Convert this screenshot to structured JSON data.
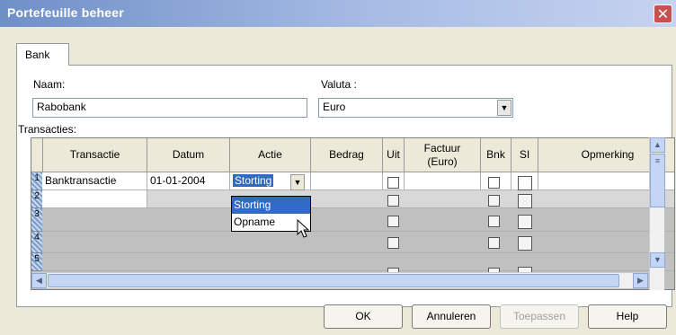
{
  "window": {
    "title": "Portefeuille beheer"
  },
  "tabs": [
    {
      "label": "Bank"
    }
  ],
  "form": {
    "name_label": "Naam:",
    "name_value": "Rabobank",
    "currency_label": "Valuta :",
    "currency_value": "Euro",
    "transactions_label": "Transacties:"
  },
  "grid": {
    "columns": [
      "Transactie",
      "Datum",
      "Actie",
      "Bedrag",
      "Uit",
      "Factuur\n(Euro)",
      "Bnk",
      "SI",
      "Opmerking"
    ],
    "row_numbers": [
      "1",
      "2",
      "3",
      "4",
      "5"
    ],
    "rows": [
      {
        "transactie": "Banktransactie",
        "datum": "01-01-2004",
        "actie": "Storting"
      }
    ]
  },
  "dropdown": {
    "options": [
      "Storting",
      "Opname"
    ],
    "selected": "Storting"
  },
  "buttons": {
    "ok": "OK",
    "cancel": "Annuleren",
    "apply": "Toepassen",
    "help": "Help"
  },
  "colors": {
    "title_gradient_start": "#6F8FC8",
    "selection": "#316AC5"
  }
}
